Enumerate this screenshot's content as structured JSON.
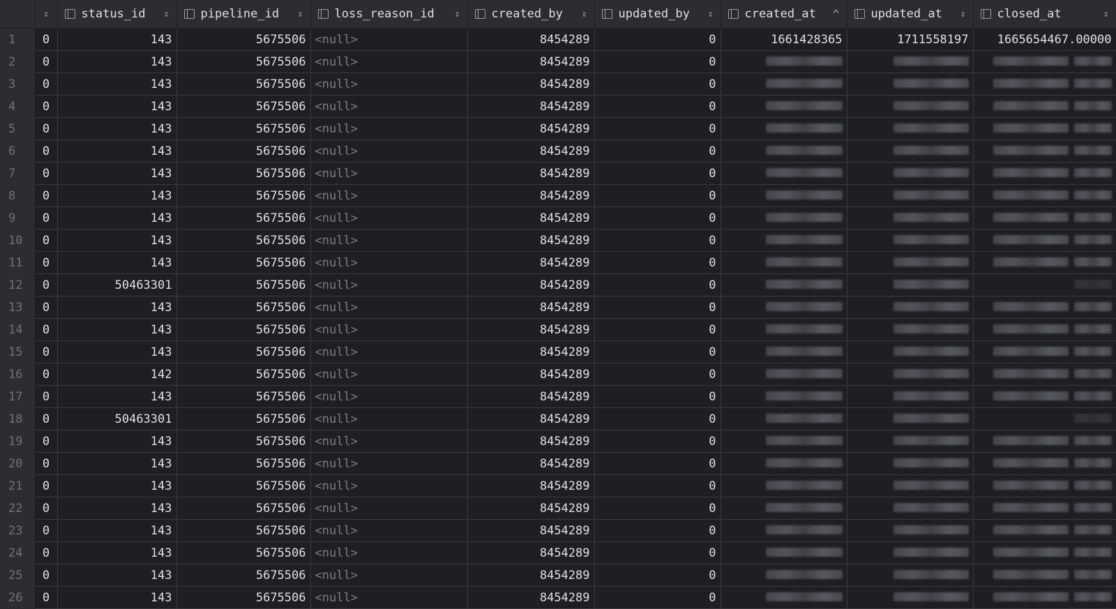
{
  "columns": [
    {
      "key": "c0",
      "label": "",
      "sort": "both"
    },
    {
      "key": "status_id",
      "label": "status_id",
      "sort": "both"
    },
    {
      "key": "pipeline_id",
      "label": "pipeline_id",
      "sort": "both"
    },
    {
      "key": "loss_reason_id",
      "label": "loss_reason_id",
      "sort": "both"
    },
    {
      "key": "created_by",
      "label": "created_by",
      "sort": "both"
    },
    {
      "key": "updated_by",
      "label": "updated_by",
      "sort": "both"
    },
    {
      "key": "created_at",
      "label": "created_at",
      "sort": "asc"
    },
    {
      "key": "updated_at",
      "label": "updated_at",
      "sort": "both"
    },
    {
      "key": "closed_at",
      "label": "closed_at",
      "sort": "both"
    }
  ],
  "sort_glyphs": {
    "both": "⇕",
    "asc": "^"
  },
  "null_text": "<null>",
  "rows": [
    {
      "n": "1",
      "c0": "0",
      "status_id": "143",
      "pipeline_id": "5675506",
      "created_by": "8454289",
      "updated_by": "0",
      "created_at": "1661428365",
      "updated_at": "1711558197",
      "closed_at": "1665654467.00000"
    },
    {
      "n": "2",
      "c0": "0",
      "status_id": "143",
      "pipeline_id": "5675506",
      "created_by": "8454289",
      "updated_by": "0"
    },
    {
      "n": "3",
      "c0": "0",
      "status_id": "143",
      "pipeline_id": "5675506",
      "created_by": "8454289",
      "updated_by": "0"
    },
    {
      "n": "4",
      "c0": "0",
      "status_id": "143",
      "pipeline_id": "5675506",
      "created_by": "8454289",
      "updated_by": "0"
    },
    {
      "n": "5",
      "c0": "0",
      "status_id": "143",
      "pipeline_id": "5675506",
      "created_by": "8454289",
      "updated_by": "0"
    },
    {
      "n": "6",
      "c0": "0",
      "status_id": "143",
      "pipeline_id": "5675506",
      "created_by": "8454289",
      "updated_by": "0"
    },
    {
      "n": "7",
      "c0": "0",
      "status_id": "143",
      "pipeline_id": "5675506",
      "created_by": "8454289",
      "updated_by": "0"
    },
    {
      "n": "8",
      "c0": "0",
      "status_id": "143",
      "pipeline_id": "5675506",
      "created_by": "8454289",
      "updated_by": "0"
    },
    {
      "n": "9",
      "c0": "0",
      "status_id": "143",
      "pipeline_id": "5675506",
      "created_by": "8454289",
      "updated_by": "0"
    },
    {
      "n": "10",
      "c0": "0",
      "status_id": "143",
      "pipeline_id": "5675506",
      "created_by": "8454289",
      "updated_by": "0"
    },
    {
      "n": "11",
      "c0": "0",
      "status_id": "143",
      "pipeline_id": "5675506",
      "created_by": "8454289",
      "updated_by": "0"
    },
    {
      "n": "12",
      "c0": "0",
      "status_id": "50463301",
      "pipeline_id": "5675506",
      "created_by": "8454289",
      "updated_by": "0",
      "closed_blank": true
    },
    {
      "n": "13",
      "c0": "0",
      "status_id": "143",
      "pipeline_id": "5675506",
      "created_by": "8454289",
      "updated_by": "0"
    },
    {
      "n": "14",
      "c0": "0",
      "status_id": "143",
      "pipeline_id": "5675506",
      "created_by": "8454289",
      "updated_by": "0"
    },
    {
      "n": "15",
      "c0": "0",
      "status_id": "143",
      "pipeline_id": "5675506",
      "created_by": "8454289",
      "updated_by": "0"
    },
    {
      "n": "16",
      "c0": "0",
      "status_id": "142",
      "pipeline_id": "5675506",
      "created_by": "8454289",
      "updated_by": "0"
    },
    {
      "n": "17",
      "c0": "0",
      "status_id": "143",
      "pipeline_id": "5675506",
      "created_by": "8454289",
      "updated_by": "0"
    },
    {
      "n": "18",
      "c0": "0",
      "status_id": "50463301",
      "pipeline_id": "5675506",
      "created_by": "8454289",
      "updated_by": "0",
      "closed_blank": true
    },
    {
      "n": "19",
      "c0": "0",
      "status_id": "143",
      "pipeline_id": "5675506",
      "created_by": "8454289",
      "updated_by": "0"
    },
    {
      "n": "20",
      "c0": "0",
      "status_id": "143",
      "pipeline_id": "5675506",
      "created_by": "8454289",
      "updated_by": "0"
    },
    {
      "n": "21",
      "c0": "0",
      "status_id": "143",
      "pipeline_id": "5675506",
      "created_by": "8454289",
      "updated_by": "0"
    },
    {
      "n": "22",
      "c0": "0",
      "status_id": "143",
      "pipeline_id": "5675506",
      "created_by": "8454289",
      "updated_by": "0"
    },
    {
      "n": "23",
      "c0": "0",
      "status_id": "143",
      "pipeline_id": "5675506",
      "created_by": "8454289",
      "updated_by": "0"
    },
    {
      "n": "24",
      "c0": "0",
      "status_id": "143",
      "pipeline_id": "5675506",
      "created_by": "8454289",
      "updated_by": "0"
    },
    {
      "n": "25",
      "c0": "0",
      "status_id": "143",
      "pipeline_id": "5675506",
      "created_by": "8454289",
      "updated_by": "0"
    },
    {
      "n": "26",
      "c0": "0",
      "status_id": "143",
      "pipeline_id": "5675506",
      "created_by": "8454289",
      "updated_by": "0"
    }
  ],
  "colors": {
    "background": "#1e1f22",
    "header": "#2b2d30",
    "grid_line": "#393b40",
    "text": "#dfe1e5",
    "null_text": "#7a7e85",
    "row_number": "#6f737a"
  }
}
